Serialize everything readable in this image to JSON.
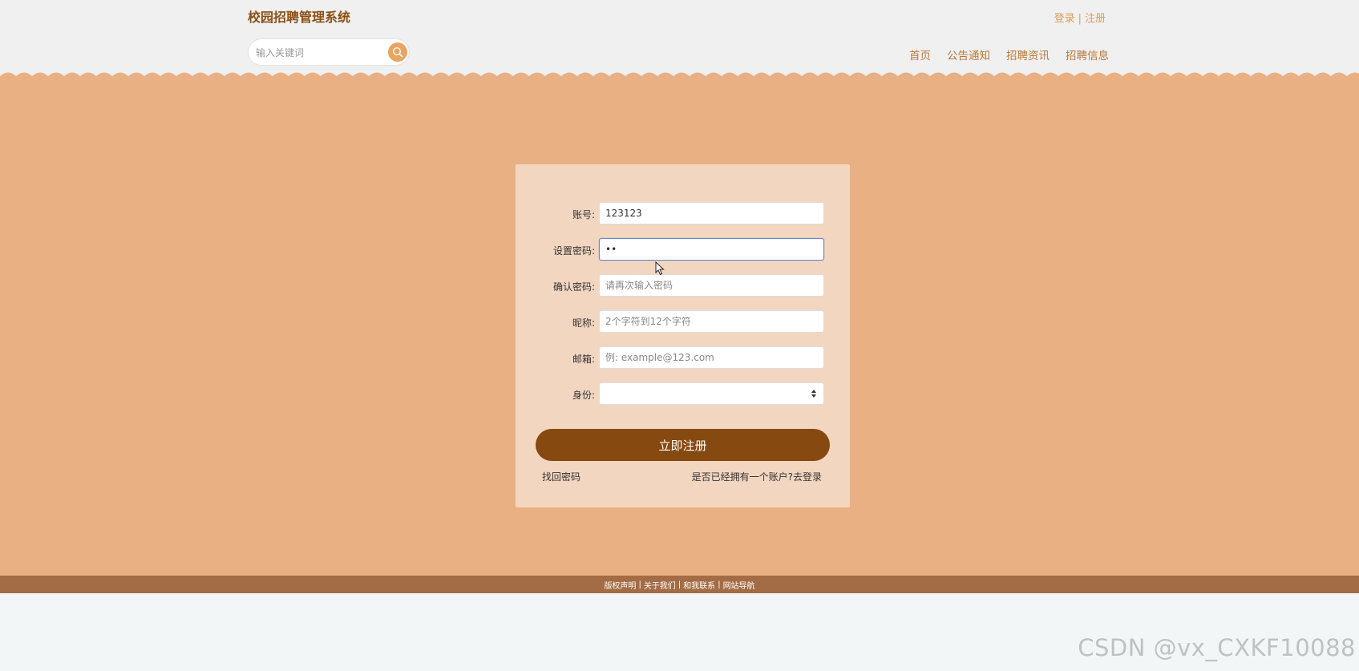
{
  "header": {
    "title": "校园招聘管理系统",
    "login_link": "登录",
    "separator": "|",
    "register_link": "注册",
    "search_placeholder": "输入关键词",
    "nav": [
      "首页",
      "公告通知",
      "招聘资讯",
      "招聘信息"
    ]
  },
  "form": {
    "account": {
      "label": "账号:",
      "value": "123123"
    },
    "password": {
      "label": "设置密码:",
      "value": "••"
    },
    "confirm_password": {
      "label": "确认密码:",
      "placeholder": "请再次输入密码"
    },
    "nickname": {
      "label": "昵称:",
      "placeholder": "2个字符到12个字符"
    },
    "email": {
      "label": "邮箱:",
      "placeholder": "例: example@123.com"
    },
    "identity": {
      "label": "身份:",
      "value": ""
    },
    "submit_label": "立即注册",
    "forgot_password": "找回密码",
    "have_account_text": "是否已经拥有一个账户?",
    "go_login": "去登录"
  },
  "footer": {
    "links": [
      "版权声明",
      "关于我们",
      "和我联系",
      "网站导航"
    ],
    "separator": "|"
  },
  "watermark": "CSDN @vx_CXKF10088",
  "colors": {
    "header_bg": "#f0f0f0",
    "main_bg": "#e9b083",
    "card_bg": "#f3d6c0",
    "primary_button": "#86490f",
    "footer_bg": "#a46c45",
    "title_color": "#8a4f14",
    "nav_color": "#b8793a"
  },
  "icons": {
    "search": "search-icon",
    "select_arrows": "sort-arrows-icon",
    "cursor": "mouse-pointer-icon"
  }
}
